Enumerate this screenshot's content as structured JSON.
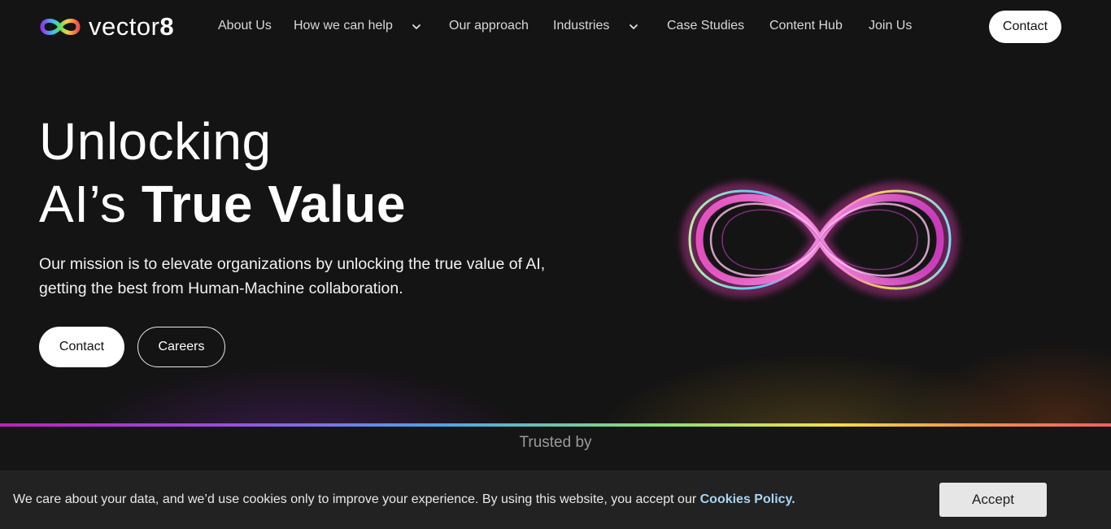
{
  "brand": {
    "name_regular": "vector",
    "name_bold": "8",
    "logo_icon": "infinity-logo-icon"
  },
  "nav": {
    "items": [
      {
        "label": "About Us",
        "dropdown": false
      },
      {
        "label": "How we can help",
        "dropdown": true
      },
      {
        "label": "Our approach",
        "dropdown": false
      },
      {
        "label": "Industries",
        "dropdown": true
      },
      {
        "label": "Case Studies",
        "dropdown": false
      },
      {
        "label": "Content Hub",
        "dropdown": false
      },
      {
        "label": "Join Us",
        "dropdown": false
      }
    ],
    "contact_label": "Contact",
    "dropdown_icon": "chevron-down-icon"
  },
  "hero": {
    "title_line1": "Unlocking",
    "title_line2_regular": "AI’s ",
    "title_line2_bold": "True Value",
    "mission": "Our mission is to elevate organizations by unlocking the true value of AI, getting the best from Human-Machine collaboration.",
    "contact_label": "Contact",
    "careers_label": "Careers",
    "illustration_icon": "glowing-infinity-icon"
  },
  "trusted": {
    "label": "Trusted by"
  },
  "cookie": {
    "message": "We care about your data, and we’d use cookies only to improve your experience. By using this website, you accept our ",
    "link_label": "Cookies Policy.",
    "accept_label": "Accept"
  },
  "colors": {
    "background": "#131313",
    "cookie_bar": "#222222",
    "cookie_link": "#a8d4f0",
    "accent_magenta": "#e040d0",
    "accent_yellow": "#f5e04a"
  }
}
